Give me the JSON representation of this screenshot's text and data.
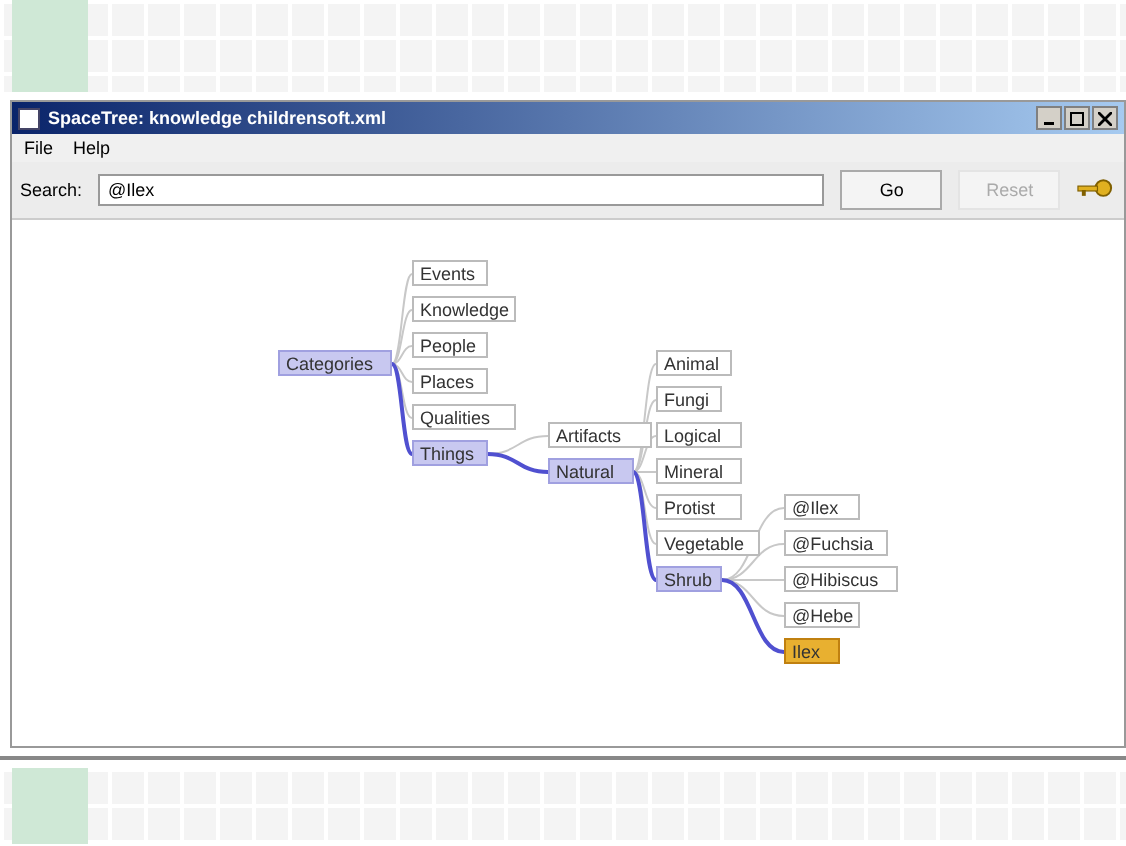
{
  "window": {
    "title": "SpaceTree: knowledge childrensoft.xml"
  },
  "menu": [
    {
      "label": "File"
    },
    {
      "label": "Help"
    }
  ],
  "search": {
    "label": "Search:",
    "value": "@Ilex",
    "buttons": [
      {
        "label": "Go",
        "disabled": false
      },
      {
        "label": "Reset",
        "disabled": true
      }
    ]
  },
  "tree": {
    "label": "Categories",
    "on_path": true,
    "selected": false,
    "children": [
      {
        "label": "Events",
        "on_path": false,
        "selected": false
      },
      {
        "label": "Knowledge",
        "on_path": false,
        "selected": false
      },
      {
        "label": "People",
        "on_path": false,
        "selected": false
      },
      {
        "label": "Places",
        "on_path": false,
        "selected": false
      },
      {
        "label": "Qualities",
        "on_path": false,
        "selected": false
      },
      {
        "label": "Things",
        "on_path": true,
        "selected": false,
        "children": [
          {
            "label": "Artifacts",
            "on_path": false,
            "selected": false
          },
          {
            "label": "Natural",
            "on_path": true,
            "selected": false,
            "children": [
              {
                "label": "Animal",
                "on_path": false,
                "selected": false
              },
              {
                "label": "Fungi",
                "on_path": false,
                "selected": false
              },
              {
                "label": "Logical",
                "on_path": false,
                "selected": false
              },
              {
                "label": "Mineral",
                "on_path": false,
                "selected": false
              },
              {
                "label": "Protist",
                "on_path": false,
                "selected": false
              },
              {
                "label": "Vegetable",
                "on_path": false,
                "selected": false
              },
              {
                "label": "Shrub",
                "on_path": true,
                "selected": false,
                "children": [
                  {
                    "label": "@Ilex",
                    "on_path": false,
                    "selected": false
                  },
                  {
                    "label": "@Fuchsia",
                    "on_path": false,
                    "selected": false
                  },
                  {
                    "label": "@Hibiscus",
                    "on_path": false,
                    "selected": false
                  },
                  {
                    "label": "@Hebe",
                    "on_path": false,
                    "selected": false
                  },
                  {
                    "label": "Ilex",
                    "on_path": true,
                    "selected": true
                  }
                ]
              }
            ]
          }
        ]
      }
    ]
  }
}
